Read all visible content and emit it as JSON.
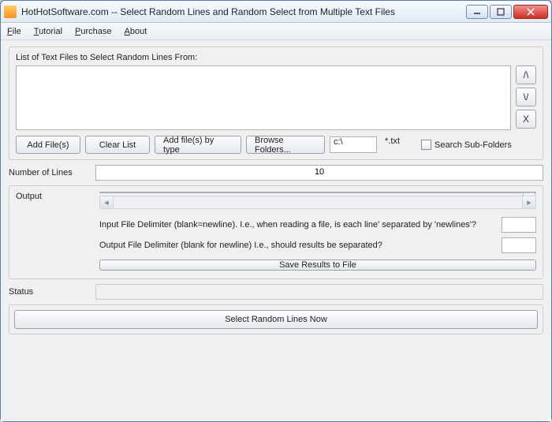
{
  "titlebar": {
    "text": "HotHotSoftware.com -- Select Random Lines and Random Select from Multiple Text Files"
  },
  "menus": {
    "file": "File",
    "tutorial": "Tutorial",
    "purchase": "Purchase",
    "about": "About"
  },
  "labels": {
    "list_heading": "List of Text Files to Select Random Lines From:",
    "number_of_lines": "Number of Lines",
    "output": "Output",
    "status": "Status",
    "input_delim": "Input File Delimiter (blank=newline). I.e., when reading a file, is each line' separated by 'newlines'?",
    "output_delim": "Output File Delimiter (blank for newline) I.e., should results be separated?",
    "search_sub": "Search Sub-Folders"
  },
  "buttons": {
    "add_files": "Add File(s)",
    "clear_list": "Clear List",
    "add_by_type": "Add file(s) by type",
    "browse_folders": "Browse Folders...",
    "save_results": "Save Results to File",
    "select_now": "Select Random Lines Now",
    "move_up": "/\\",
    "move_down": "\\/",
    "remove": "X"
  },
  "inputs": {
    "folder_path": "c:\\",
    "file_ext": "*.txt",
    "num_lines": "10",
    "input_delim_value": "",
    "output_delim_value": ""
  }
}
